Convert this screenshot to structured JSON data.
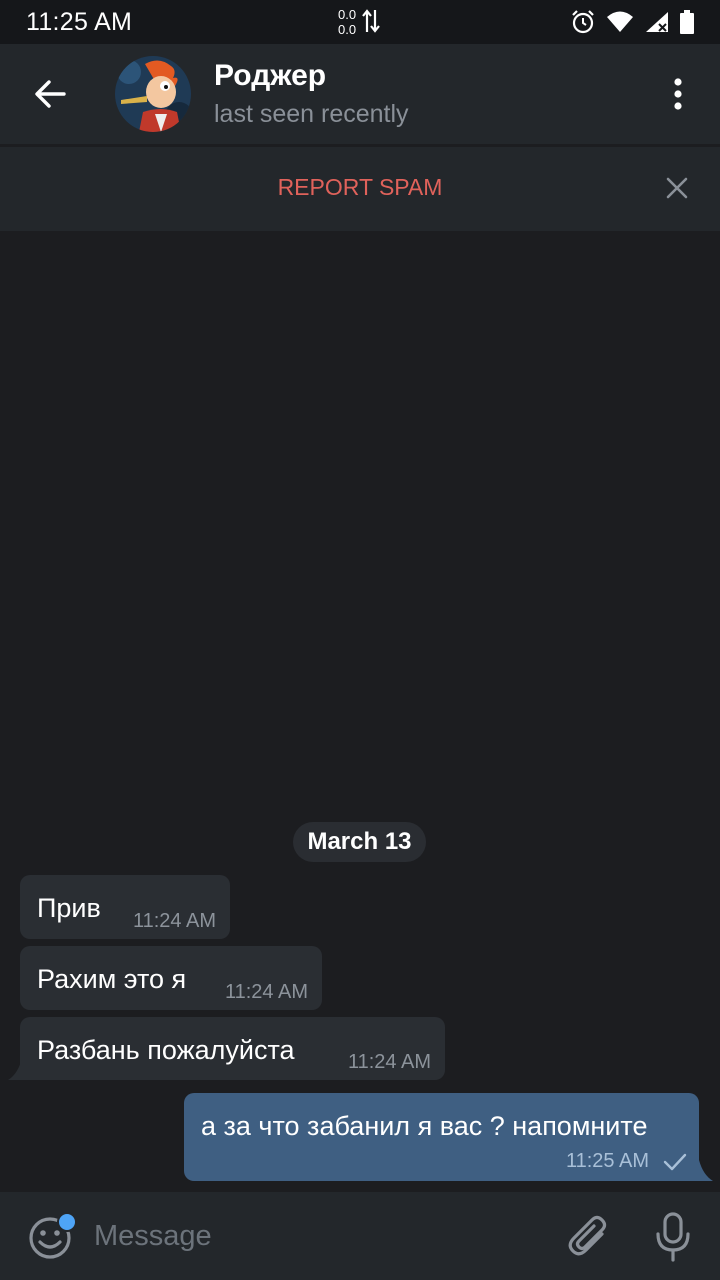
{
  "status_bar": {
    "time": "11:25 AM",
    "net_up": "0.0",
    "net_down": "0.0"
  },
  "header": {
    "contact_name": "Роджер",
    "contact_status": "last seen recently"
  },
  "spam_bar": {
    "report_label": "REPORT SPAM"
  },
  "chat": {
    "date_separator": "March 13",
    "incoming": [
      {
        "text": "Прив",
        "time": "11:24 AM"
      },
      {
        "text": "Рахим это я",
        "time": "11:24 AM"
      },
      {
        "text": "Разбань пожалуйста",
        "time": "11:24 AM"
      }
    ],
    "outgoing": [
      {
        "text": "а за что забанил я вас ? напомните",
        "time": "11:25 AM",
        "status": "sent"
      }
    ]
  },
  "input_bar": {
    "placeholder": "Message"
  },
  "colors": {
    "background": "#1c1d20",
    "header": "#23272b",
    "incoming_bubble": "#2a2e33",
    "outgoing_bubble": "#3f5f82",
    "report_spam": "#e0625b",
    "accent": "#4ea4f6"
  },
  "icons": [
    "back-arrow-icon",
    "more-vertical-icon",
    "close-icon",
    "emoji-icon",
    "attach-icon",
    "microphone-icon",
    "check-icon",
    "alarm-icon",
    "wifi-icon",
    "signal-icon",
    "battery-icon",
    "data-arrows-icon"
  ]
}
